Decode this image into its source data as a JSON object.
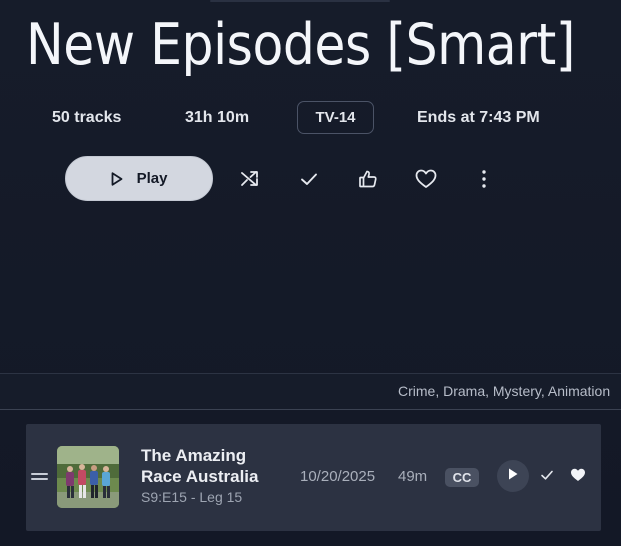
{
  "header": {
    "title": "New Episodes [Smart]"
  },
  "meta": {
    "tracks": "50 tracks",
    "duration": "31h 10m",
    "rating": "TV-14",
    "ends_at": "Ends at 7:43 PM"
  },
  "actions": {
    "play_label": "Play",
    "icons": [
      "play-icon",
      "shuffle-icon",
      "check-icon",
      "thumbs-up-icon",
      "heart-icon",
      "more-vertical-icon"
    ]
  },
  "genres": "Crime, Drama, Mystery, Animation",
  "episode": {
    "title": "The Amazing Race Australia",
    "subtitle": "S9:E15 - Leg 15",
    "date": "10/20/2025",
    "length": "49m",
    "badge": "CC",
    "icons": [
      "drag-handle-icon",
      "play-icon",
      "check-icon",
      "heart-icon"
    ]
  },
  "colors": {
    "background": "#141a27",
    "row_background": "#2c3242",
    "play_button": "#d3d7e0",
    "text_primary": "#f4f6fa",
    "text_secondary": "#a9afbb"
  }
}
